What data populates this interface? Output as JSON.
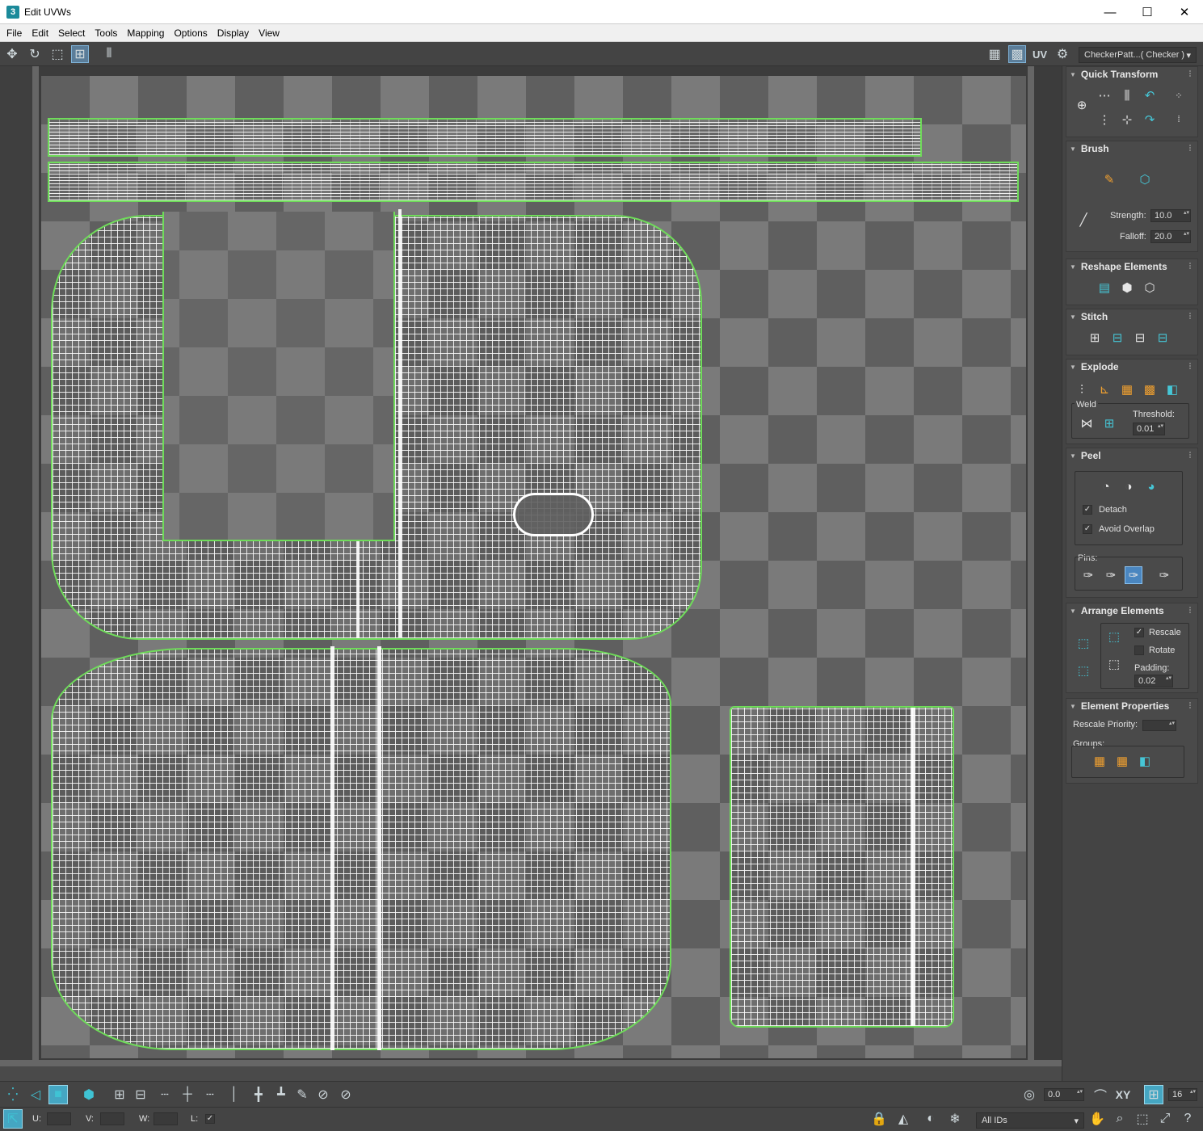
{
  "window": {
    "title": "Edit UVWs",
    "app_icon": "3",
    "minimize": "—",
    "maximize": "☐",
    "close": "✕"
  },
  "menu": [
    "File",
    "Edit",
    "Select",
    "Tools",
    "Mapping",
    "Options",
    "Display",
    "View"
  ],
  "toolbar": {
    "uv_label": "UV",
    "texture_dropdown": "CheckerPatt...( Checker )",
    "dropdown_arrow": "▾"
  },
  "panel": {
    "quick_transform": {
      "title": "Quick Transform"
    },
    "brush": {
      "title": "Brush",
      "strength_label": "Strength:",
      "strength_value": "10.0",
      "falloff_label": "Falloff:",
      "falloff_value": "20.0"
    },
    "reshape": {
      "title": "Reshape Elements"
    },
    "stitch": {
      "title": "Stitch"
    },
    "explode": {
      "title": "Explode",
      "weld_label": "Weld",
      "threshold_label": "Threshold:",
      "threshold_value": "0.01"
    },
    "peel": {
      "title": "Peel",
      "detach_label": "Detach",
      "detach_checked": "✓",
      "avoid_overlap_label": "Avoid Overlap",
      "avoid_overlap_checked": "✓",
      "pins_label": "Pins:"
    },
    "arrange": {
      "title": "Arrange Elements",
      "rescale_label": "Rescale",
      "rescale_checked": "✓",
      "rotate_label": "Rotate",
      "rotate_checked": "",
      "padding_label": "Padding:",
      "padding_value": "0.02"
    },
    "element_properties": {
      "title": "Element Properties",
      "rescale_priority_label": "Rescale Priority:",
      "groups_label": "Groups:"
    }
  },
  "bottom": {
    "angle_value": "0.0",
    "xy_label": "XY",
    "snap_value": "16",
    "u_label": "U:",
    "v_label": "V:",
    "w_label": "W:",
    "l_label": "L:",
    "l_checked": "✓",
    "ids_dropdown": "All IDs"
  },
  "colors": {
    "seam_green": "#6fdc5a",
    "accent_blue": "#4a86c0",
    "teal": "#46c6d6"
  }
}
